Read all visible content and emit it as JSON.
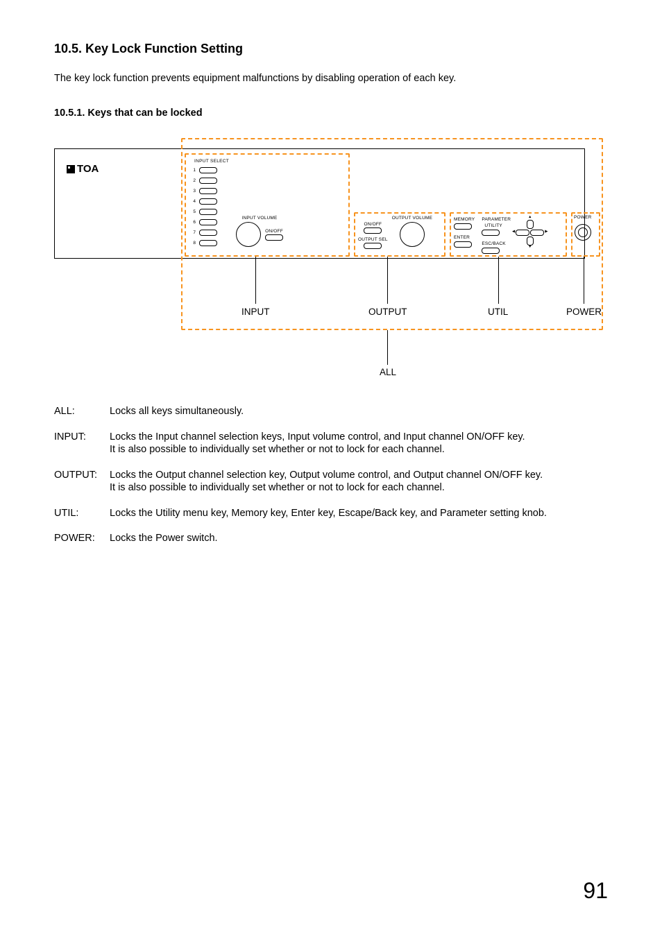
{
  "heading": "10.5. Key Lock Function Setting",
  "intro": "The key lock function prevents equipment malfunctions by disabling operation of each key.",
  "sub_heading": "10.5.1. Keys that can be locked",
  "logo_text": "TOA",
  "panel": {
    "input_select_title": "INPUT SELECT",
    "input_channels": [
      "1",
      "2",
      "3",
      "4",
      "5",
      "6",
      "7",
      "8"
    ],
    "input_volume_label": "INPUT VOLUME",
    "on_off_label": "ON/OFF",
    "output_volume_label": "OUTPUT VOLUME",
    "output_sel_label": "OUTPUT SEL",
    "memory_label": "MEMORY",
    "enter_label": "ENTER",
    "parameter_label": "PARAMETER",
    "utility_label": "UTILITY",
    "esc_back_label": "ESC/BACK",
    "power_label": "POWER"
  },
  "group_labels": {
    "input": "INPUT",
    "output": "OUTPUT",
    "util": "UTIL",
    "power": "POWER",
    "all": "ALL"
  },
  "definitions": [
    {
      "term": "ALL:",
      "body": "Locks all keys simultaneously."
    },
    {
      "term": "INPUT:",
      "body": "Locks the Input channel selection keys, Input volume control, and Input channel ON/OFF key.\nIt is also possible to individually set whether or not to lock for each channel."
    },
    {
      "term": "OUTPUT:",
      "body": "Locks the Output channel selection key, Output volume control, and Output channel ON/OFF key.\nIt is also possible to individually set whether or not to lock for each channel."
    },
    {
      "term": "UTIL:",
      "body": "Locks the Utility menu key, Memory key, Enter key, Escape/Back key, and Parameter setting knob."
    },
    {
      "term": "POWER:",
      "body": "Locks the Power switch."
    }
  ],
  "page_number": "91"
}
